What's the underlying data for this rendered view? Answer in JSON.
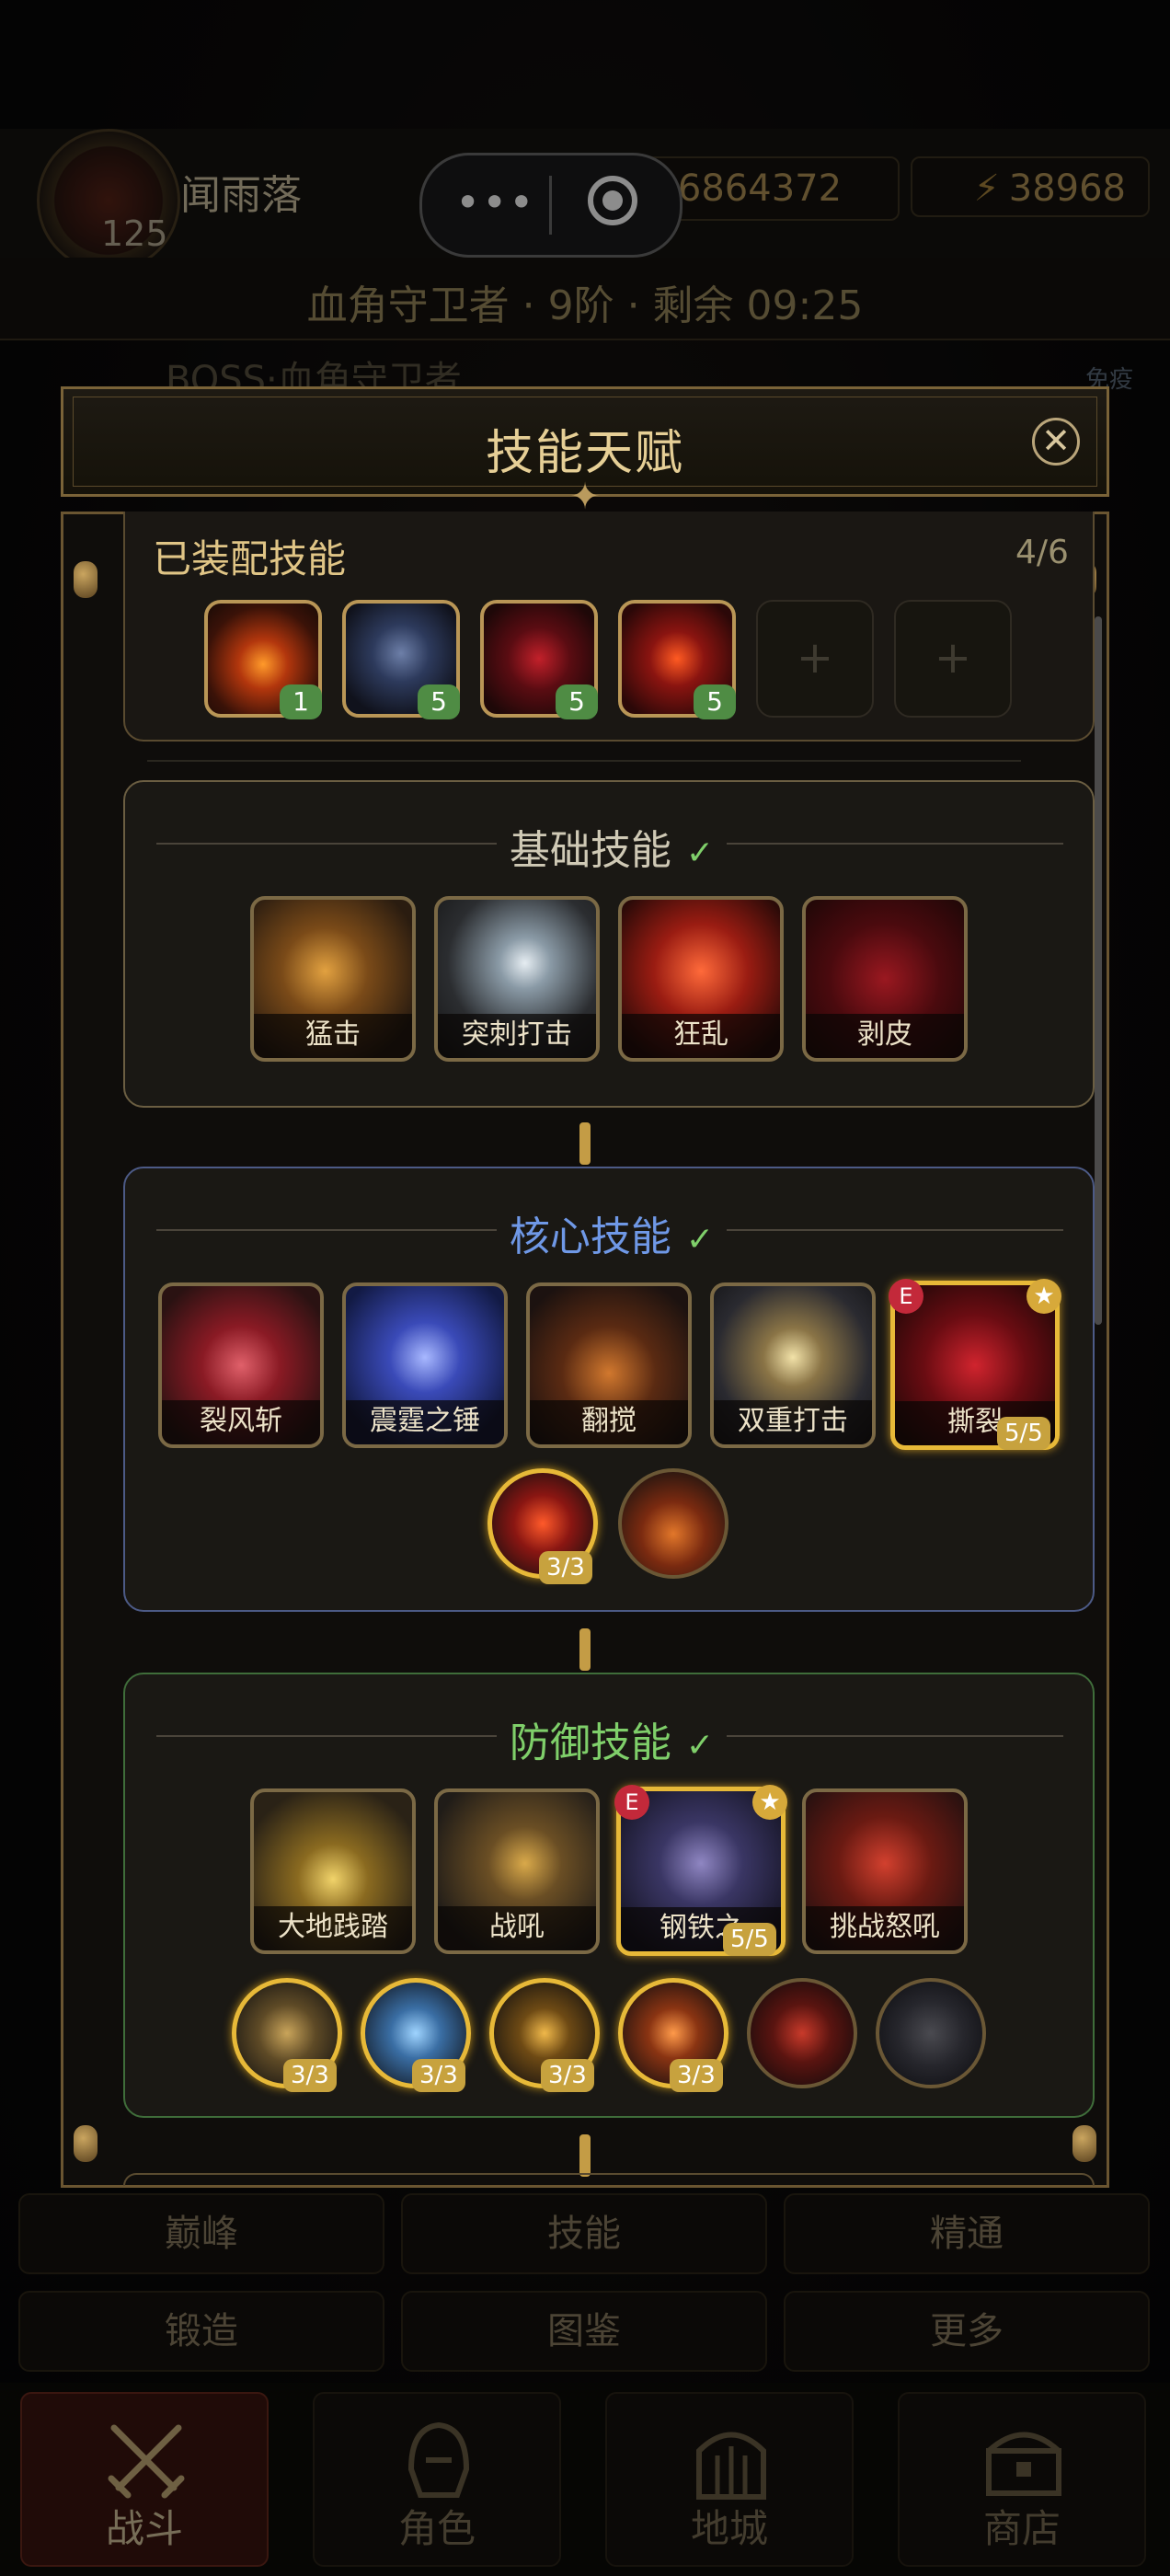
{
  "player": {
    "name": "闻雨落",
    "level": "125",
    "gold": "456864372",
    "energy": "38968"
  },
  "stage": {
    "text": "血角守卫者 · 9阶 · 剩余 09:25"
  },
  "boss": {
    "label": "BOSS·血角守卫者",
    "immune": "免疫"
  },
  "modal": {
    "title": "技能天赋"
  },
  "equipped": {
    "title": "已装配技能",
    "count": "4/6",
    "slots": [
      {
        "level": "1",
        "icon": "fire-demon-skill-icon"
      },
      {
        "level": "5",
        "icon": "armored-knight-skill-icon"
      },
      {
        "level": "5",
        "icon": "blood-whip-skill-icon"
      },
      {
        "level": "5",
        "icon": "crimson-burst-skill-icon"
      }
    ],
    "empty_symbol": "+"
  },
  "sections": {
    "basic": {
      "title": "基础技能",
      "check": "✓",
      "skills": [
        "猛击",
        "突刺打击",
        "狂乱",
        "剥皮"
      ]
    },
    "core": {
      "title": "核心技能",
      "check": "✓",
      "skills": [
        "裂风斩",
        "震霆之锤",
        "翻搅",
        "双重打击",
        "撕裂"
      ],
      "selected_badge": "E",
      "selected_level": "5/5",
      "passives": [
        {
          "level": "3/3"
        },
        {
          "level": ""
        }
      ]
    },
    "defense": {
      "title": "防御技能",
      "check": "✓",
      "skills": [
        "大地践踏",
        "战吼",
        "钢铁之",
        "挑战怒吼"
      ],
      "selected_badge": "E",
      "selected_level": "5/5",
      "passives": [
        {
          "level": "3/3"
        },
        {
          "level": "3/3"
        },
        {
          "level": "3/3"
        },
        {
          "level": "3/3"
        },
        {
          "level": ""
        },
        {
          "level": ""
        }
      ]
    }
  },
  "menu": [
    "巅峰",
    "技能",
    "精通",
    "锻造",
    "图鉴",
    "更多"
  ],
  "nav": [
    "战斗",
    "角色",
    "地城",
    "商店"
  ],
  "colors": {
    "gold": "#e7b938",
    "basic": "#cfc9b5",
    "core": "#6f98e6",
    "defense": "#7fcf6a",
    "level_green": "#4f8c44"
  }
}
